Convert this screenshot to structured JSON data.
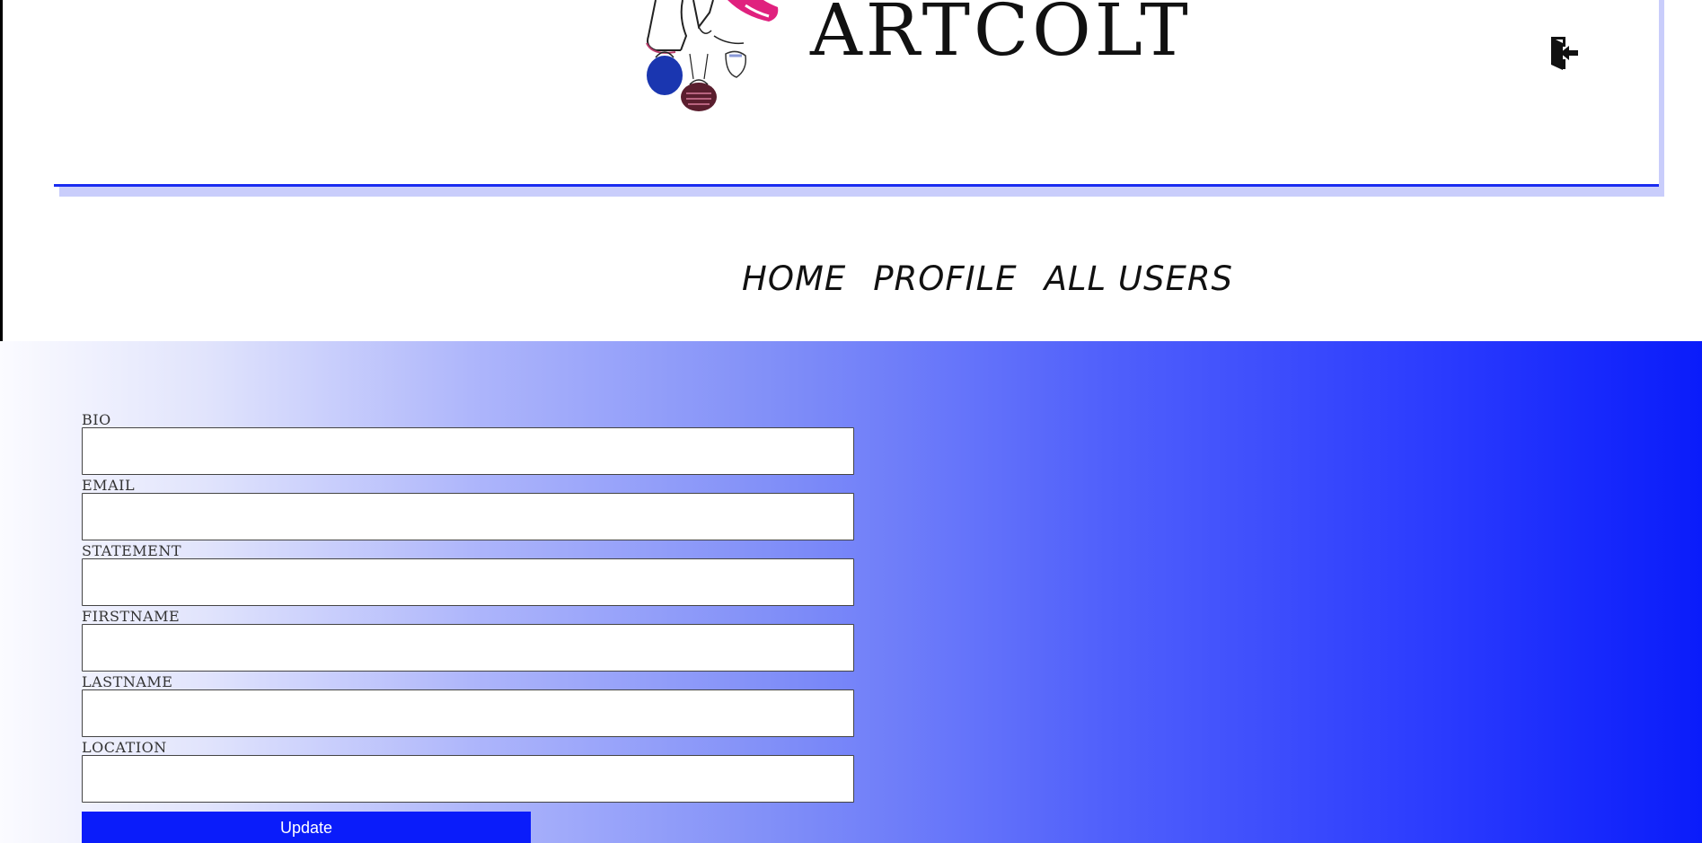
{
  "header": {
    "brand": "ARTCOLT",
    "logo_icon": "fashion-sketch-logo",
    "logout_icon": "door-exit-icon"
  },
  "nav": {
    "items": [
      {
        "label": "HOME"
      },
      {
        "label": "PROFILE"
      },
      {
        "label": "ALL USERS"
      }
    ]
  },
  "form": {
    "fields": [
      {
        "label": "BIO",
        "value": "",
        "placeholder": ""
      },
      {
        "label": "EMAIL",
        "value": "",
        "placeholder": ""
      },
      {
        "label": "STATEMENT",
        "value": "",
        "placeholder": ""
      },
      {
        "label": "FIRSTNAME",
        "value": "",
        "placeholder": ""
      },
      {
        "label": "LASTNAME",
        "value": "",
        "placeholder": ""
      },
      {
        "label": "LOCATION",
        "value": "",
        "placeholder": ""
      }
    ],
    "submit_label": "Update"
  },
  "colors": {
    "accent": "#0a1cfa",
    "header_rule": "#1a2cf0",
    "gradient_start": "#fbfbff",
    "gradient_end": "#0a1cfa"
  }
}
